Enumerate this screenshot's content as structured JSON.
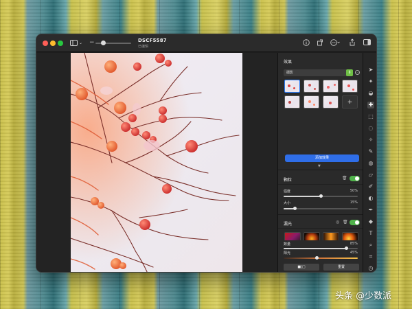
{
  "window": {
    "title": "DSCF5587",
    "subtitle": "已编辑"
  },
  "titlebar_icons": {
    "sidebar": "sidebar-icon",
    "chevron": "chevron-down-icon",
    "zoom_out": "minus-icon",
    "zoom_in": "plus-icon",
    "info": "info-icon",
    "rotate": "rotate-icon",
    "more": "ellipsis-icon",
    "share": "share-icon",
    "panel_toggle": "panel-icon"
  },
  "effects_panel": {
    "title": "效果",
    "preset_dropdown": "摄影",
    "add_button": "添加效果"
  },
  "grain": {
    "title": "颗粒",
    "enabled": true,
    "sliders": [
      {
        "label": "强度",
        "value_text": "50%",
        "value": 0.5
      },
      {
        "label": "大小",
        "value_text": "15%",
        "value": 0.15
      }
    ]
  },
  "light_leak": {
    "title": "漏光",
    "enabled": true,
    "sliders": [
      {
        "label": "数量",
        "value_text": "85%",
        "value": 0.85
      },
      {
        "label": "阳光",
        "value_text": "45%",
        "value": 0.45
      }
    ]
  },
  "buttons": {
    "compare": "■|□",
    "reset": "重置"
  },
  "colors": {
    "accent_blue": "#2f6ee8",
    "toggle_green": "#4fb34a",
    "persimmon": "#e0503a"
  },
  "watermark": "头条 @少数派"
}
